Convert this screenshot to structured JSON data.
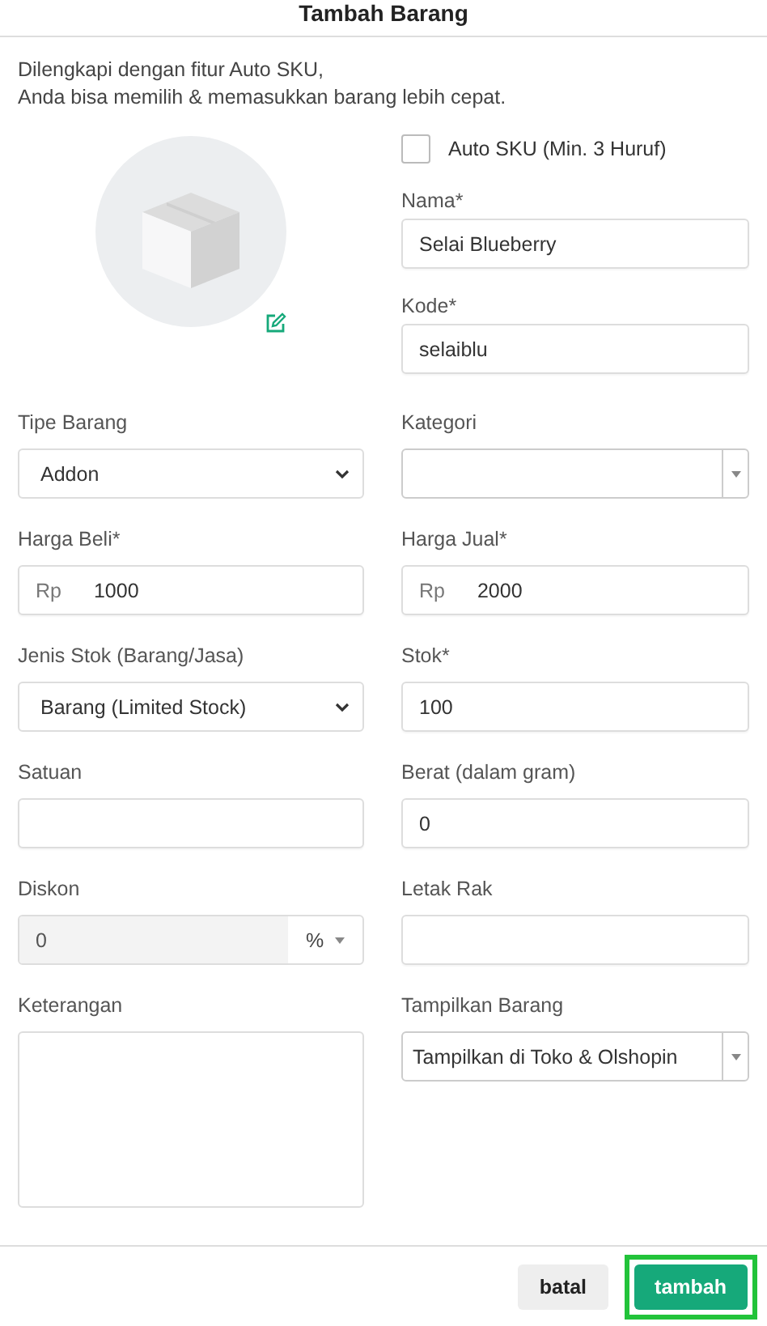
{
  "dialog": {
    "title": "Tambah Barang"
  },
  "intro": [
    "Dilengkapi dengan fitur Auto SKU,",
    "Anda bisa memilih & memasukkan barang lebih cepat."
  ],
  "auto_sku": {
    "label": "Auto SKU (Min. 3 Huruf)",
    "checked": false
  },
  "top_fields": [
    {
      "label": "Nama*",
      "value": "Selai Blueberry"
    },
    {
      "label": "Kode*",
      "value": "selaiblu"
    }
  ],
  "fields": [
    {
      "kind": "select",
      "label": "Tipe Barang",
      "value": "Addon"
    },
    {
      "kind": "combo",
      "label": "Kategori"
    },
    {
      "kind": "prefix",
      "label": "Harga Beli*",
      "prefix": "Rp",
      "value": "1000"
    },
    {
      "kind": "prefix",
      "label": "Harga Jual*",
      "prefix": "Rp",
      "value": "2000"
    },
    {
      "kind": "select",
      "label": "Jenis Stok (Barang/Jasa)",
      "value": "Barang (Limited Stock)"
    },
    {
      "kind": "text",
      "label": "Stok*",
      "value": "100"
    },
    {
      "kind": "text",
      "label": "Satuan"
    },
    {
      "kind": "text",
      "label": "Berat (dalam gram)",
      "value": "0"
    },
    {
      "kind": "discount",
      "label": "Diskon",
      "value": "0",
      "unit": "%"
    },
    {
      "kind": "text",
      "label": "Letak Rak"
    },
    {
      "kind": "textarea",
      "label": "Keterangan"
    },
    {
      "kind": "combo",
      "label": "Tampilkan Barang",
      "value": "Tampilkan di Toko & Olshopin"
    }
  ],
  "buttons": [
    {
      "kind": "cancel",
      "label": "batal",
      "highlighted": false
    },
    {
      "kind": "primary",
      "label": "tambah",
      "highlighted": true
    }
  ]
}
